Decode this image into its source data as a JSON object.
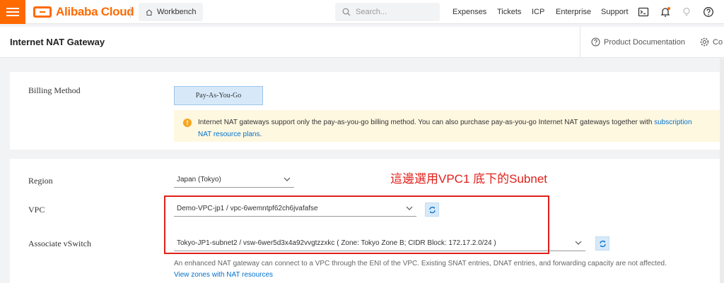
{
  "topbar": {
    "logo_text": "Alibaba Cloud",
    "workbench_label": "Workbench",
    "search_placeholder": "Search...",
    "nav": {
      "expenses": "Expenses",
      "tickets": "Tickets",
      "icp": "ICP",
      "enterprise": "Enterprise",
      "support": "Support"
    }
  },
  "header": {
    "title": "Internet NAT Gateway",
    "product_documentation": "Product Documentation",
    "console_truncated": "Co"
  },
  "billing": {
    "label": "Billing Method",
    "option": "Pay-As-You-Go",
    "notice_text": "Internet NAT gateways support only the pay-as-you-go billing method. You can also purchase pay-as-you-go Internet NAT gateways together with ",
    "notice_link_1": "subscription",
    "notice_link_2": "NAT resource plans",
    "notice_end": "."
  },
  "form": {
    "region_label": "Region",
    "region_value": "Japan (Tokyo)",
    "vpc_label": "VPC",
    "vpc_value": "Demo-VPC-jp1 / vpc-6wemntpf62ch6jvafafse",
    "vswitch_label": "Associate vSwitch",
    "vswitch_value": "Tokyo-JP1-subnet2 / vsw-6wer5d3x4a92vvgtzzxkc ( Zone: Tokyo Zone B; CIDR Block: 172.17.2.0/24 )",
    "helper_text": "An enhanced NAT gateway can connect to a VPC through the ENI of the VPC. Existing SNAT entries, DNAT entries, and forwarding capacity are not affected.",
    "helper_link": "View zones with NAT resources"
  },
  "annotation": {
    "text": "這邊選用VPC1 底下的Subnet"
  },
  "colors": {
    "brand": "#ff6a00",
    "link": "#0070cc",
    "annotation": "#e0201b",
    "notice_bg": "#fff8e1"
  }
}
